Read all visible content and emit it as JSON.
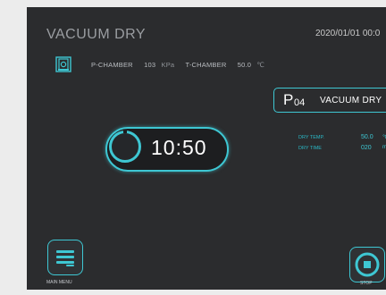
{
  "header": {
    "title": "VACUUM DRY",
    "datetime": "2020/01/01  00:0"
  },
  "status": {
    "p_chamber_label": "P-CHAMBER",
    "p_chamber_value": "103",
    "p_chamber_unit": "KPa",
    "t_chamber_label": "T-CHAMBER",
    "t_chamber_value": "50.0",
    "t_chamber_unit": "℃"
  },
  "program": {
    "prefix": "P",
    "number": "04",
    "name": "VACUUM DRY"
  },
  "parameters": [
    {
      "label": "DRY TEMP.",
      "value": "50.0",
      "unit": "℃"
    },
    {
      "label": "DRY TIME",
      "value": "020",
      "unit": "m"
    }
  ],
  "timer": {
    "time": "10:50"
  },
  "footer": {
    "main_menu_label": "MAIN MENU",
    "stop_label": "STOP"
  },
  "colors": {
    "accent": "#3ec7d3",
    "background": "#2b2c2e"
  },
  "icons": {
    "chamber": "vacuum-chamber-icon",
    "menu": "menu-icon",
    "stop": "stop-icon"
  }
}
